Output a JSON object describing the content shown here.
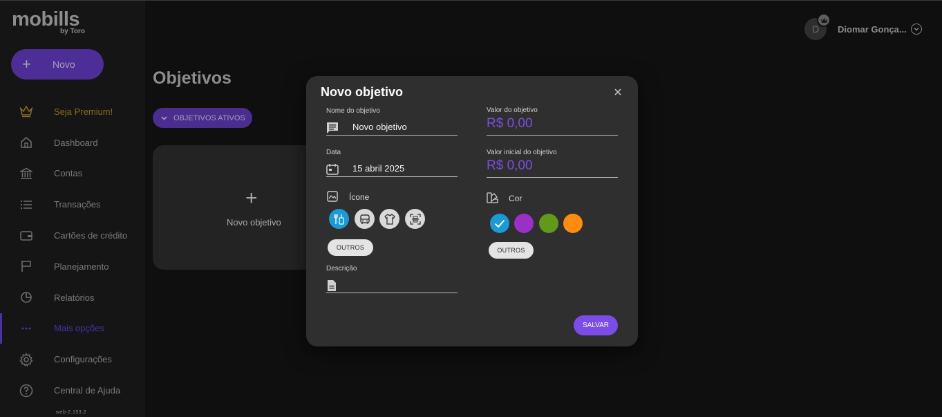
{
  "app": {
    "logo": "mobills",
    "logo_sub": "by Toro",
    "version": "web-2.153.2"
  },
  "sidebar": {
    "new_label": "Novo",
    "items": [
      {
        "label": "Seja Premium!",
        "icon": "crown-icon"
      },
      {
        "label": "Dashboard",
        "icon": "home-icon"
      },
      {
        "label": "Contas",
        "icon": "bank-icon"
      },
      {
        "label": "Transações",
        "icon": "list-icon"
      },
      {
        "label": "Cartões de crédito",
        "icon": "credit-card-icon"
      },
      {
        "label": "Planejamento",
        "icon": "flag-icon"
      },
      {
        "label": "Relatórios",
        "icon": "pie-chart-icon"
      },
      {
        "label": "Mais opções",
        "icon": "more-icon"
      },
      {
        "label": "Configurações",
        "icon": "gear-icon"
      },
      {
        "label": "Central de Ajuda",
        "icon": "help-icon"
      }
    ]
  },
  "header": {
    "avatar_initial": "D",
    "user_name": "Diomar Gonça..."
  },
  "main": {
    "title": "Objetivos",
    "filter_label": "OBJETIVOS ATIVOS",
    "new_goal_plus": "+",
    "new_goal_label": "Novo objetivo"
  },
  "modal": {
    "title": "Novo objetivo",
    "name_label": "Nome do objetivo",
    "name_value": "Novo objetivo",
    "date_label": "Data",
    "date_value": "15 abril 2025",
    "icon_section": "Ícone",
    "icon_options": [
      "food-icon",
      "bus-icon",
      "shirt-icon",
      "scan-icon"
    ],
    "icon_others": "OUTROS",
    "description_label": "Descrição",
    "goal_value_label": "Valor do objetivo",
    "goal_value": "R$ 0,00",
    "initial_value_label": "Valor inicial do objetivo",
    "initial_value": "R$ 0,00",
    "color_section": "Cor",
    "colors": [
      "#1a9ad6",
      "#9b30c9",
      "#5f9a1a",
      "#ff8c0f"
    ],
    "color_others": "OUTROS",
    "save_label": "SALVAR"
  }
}
